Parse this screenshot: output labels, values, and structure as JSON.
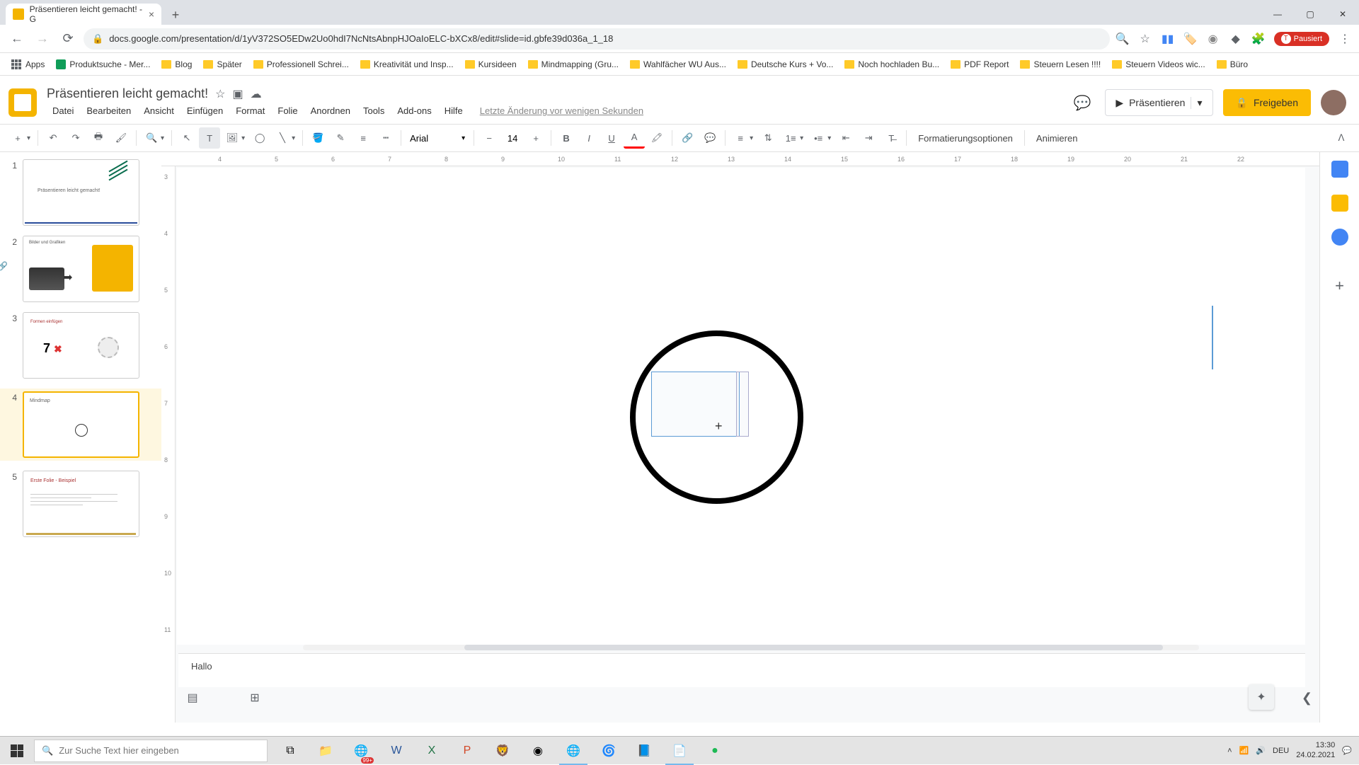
{
  "browser": {
    "tab_title": "Präsentieren leicht gemacht! - G",
    "url": "docs.google.com/presentation/d/1yV372SO5EDw2Uo0hdI7NcNtsAbnpHJOaIoELC-bXCx8/edit#slide=id.gbfe39d036a_1_18",
    "profile": "Pausiert",
    "apps_label": "Apps"
  },
  "bookmarks": [
    "Produktsuche - Mer...",
    "Blog",
    "Später",
    "Professionell Schrei...",
    "Kreativität und Insp...",
    "Kursideen",
    "Mindmapping  (Gru...",
    "Wahlfächer WU Aus...",
    "Deutsche Kurs + Vo...",
    "Noch hochladen Bu...",
    "PDF Report",
    "Steuern Lesen !!!!",
    "Steuern Videos wic...",
    "Büro"
  ],
  "doc": {
    "title": "Präsentieren leicht gemacht!",
    "last_edit": "Letzte Änderung vor wenigen Sekunden"
  },
  "menu": [
    "Datei",
    "Bearbeiten",
    "Ansicht",
    "Einfügen",
    "Format",
    "Folie",
    "Anordnen",
    "Tools",
    "Add-ons",
    "Hilfe"
  ],
  "header_buttons": {
    "present": "Präsentieren",
    "share": "Freigeben"
  },
  "toolbar": {
    "font": "Arial",
    "font_size": "14",
    "format_options": "Formatierungsoptionen",
    "animate": "Animieren"
  },
  "ruler_h": [
    "4",
    "5",
    "6",
    "7",
    "8",
    "9",
    "10",
    "11",
    "12",
    "13",
    "14",
    "15",
    "16",
    "17",
    "18",
    "19",
    "20",
    "21",
    "22"
  ],
  "ruler_v": [
    "3",
    "4",
    "5",
    "6",
    "7",
    "8",
    "9",
    "10",
    "11"
  ],
  "slides": [
    {
      "num": "1",
      "title": "Präsentieren leicht gemacht!"
    },
    {
      "num": "2",
      "title": "Bilder und Grafiken"
    },
    {
      "num": "3",
      "title": "Formen einfügen",
      "seven": "7"
    },
    {
      "num": "4",
      "title": "Mindmap"
    },
    {
      "num": "5",
      "title": "Erste Folie - Beispiel"
    }
  ],
  "notes": "Hallo",
  "taskbar": {
    "search_placeholder": "Zur Suche Text hier eingeben",
    "notif_count": "99+",
    "lang": "DEU",
    "time": "13:30",
    "date": "24.02.2021"
  }
}
